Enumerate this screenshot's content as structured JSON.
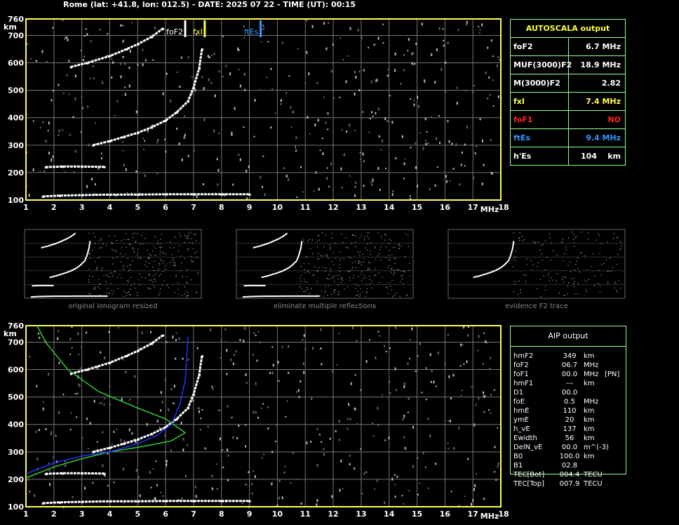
{
  "header": "Rome (lat: +41.8, lon: 012.5) - DATE: 2025 07 22 - TIME (UT): 00:15",
  "colors": {
    "axis": "#ffff55",
    "grid": "#777777",
    "trace": "#ffffff",
    "fof2": "#ffffff",
    "fxi": "#ffff44",
    "ftes": "#3399ff",
    "fof1": "#ff2222",
    "table_border": "#99ff99",
    "profile_green": "#33cc33",
    "profile_blue": "#2233ff"
  },
  "chart_data": {
    "type": "scatter",
    "xlabel": "MHz",
    "ylabel": "km",
    "xlim": [
      1,
      18
    ],
    "ylim": [
      100,
      760
    ],
    "x_ticks": [
      "1",
      "2",
      "3",
      "4",
      "5",
      "6",
      "7",
      "8",
      "9",
      "10",
      "11",
      "12",
      "13",
      "14",
      "15",
      "16",
      "17",
      "18"
    ],
    "y_ticks": [
      "100",
      "200",
      "300",
      "400",
      "500",
      "600",
      "700",
      "760"
    ],
    "markers": [
      {
        "label": "foF2",
        "freq": 6.7,
        "color": "#ffffff"
      },
      {
        "label": "fxI",
        "freq": 7.4,
        "color": "#ffff44"
      },
      {
        "label": "ftEs",
        "freq": 9.4,
        "color": "#3399ff"
      }
    ],
    "series": [
      {
        "values": [
          [
            1.6,
            113
          ],
          [
            2.2,
            116
          ],
          [
            3,
            118
          ],
          [
            4,
            120
          ],
          [
            5,
            120
          ],
          [
            6,
            121
          ],
          [
            7,
            121
          ],
          [
            8,
            121
          ],
          [
            9,
            121
          ]
        ]
      },
      {
        "values": [
          [
            1.7,
            220
          ],
          [
            2.3,
            222
          ],
          [
            3,
            222
          ],
          [
            3.8,
            221
          ]
        ]
      },
      {
        "values": [
          [
            3.4,
            300
          ],
          [
            4,
            315
          ],
          [
            4.5,
            330
          ],
          [
            5,
            345
          ],
          [
            5.5,
            365
          ],
          [
            6,
            390
          ],
          [
            6.4,
            420
          ],
          [
            6.8,
            460
          ],
          [
            7,
            510
          ],
          [
            7.2,
            580
          ],
          [
            7.3,
            650
          ]
        ]
      },
      {
        "values": [
          [
            2.6,
            585
          ],
          [
            3.2,
            600
          ],
          [
            4,
            625
          ],
          [
            4.6,
            650
          ],
          [
            5,
            668
          ],
          [
            5.5,
            695
          ],
          [
            5.9,
            725
          ]
        ]
      }
    ],
    "profiles": [
      {
        "values": [
          [
            1.4,
            760
          ],
          [
            1.7,
            700
          ],
          [
            2.5,
            600
          ],
          [
            3.6,
            520
          ],
          [
            5,
            460
          ],
          [
            6,
            420
          ],
          [
            6.7,
            370
          ],
          [
            6.2,
            340
          ],
          [
            5.2,
            320
          ],
          [
            4,
            300
          ],
          [
            3,
            275
          ],
          [
            2,
            245
          ],
          [
            1,
            205
          ]
        ]
      },
      {
        "values": [
          [
            1,
            220
          ],
          [
            2,
            260
          ],
          [
            3,
            285
          ],
          [
            4,
            300
          ],
          [
            5,
            330
          ],
          [
            5.7,
            360
          ],
          [
            6.2,
            400
          ],
          [
            6.5,
            470
          ],
          [
            6.7,
            560
          ],
          [
            6.8,
            720
          ]
        ]
      }
    ]
  },
  "autoscala": {
    "title": "AUTOSCALA output",
    "rows": [
      {
        "label": "foF2",
        "value": "6.7 MHz",
        "color": "#ffffff"
      },
      {
        "label": "MUF(3000)F2",
        "value": "18.9 MHz",
        "color": "#ffffff"
      },
      {
        "label": "M(3000)F2",
        "value": "2.82",
        "color": "#ffffff"
      },
      {
        "label": "fxI",
        "value": "7.4 MHz",
        "color": "#ffff44"
      },
      {
        "label": "foF1",
        "value": "NO",
        "color": "#ff2222"
      },
      {
        "label": "ftEs",
        "value": "9.4 MHz",
        "color": "#3399ff"
      },
      {
        "label": "h'Es",
        "value": "104    km",
        "color": "#ffffff"
      }
    ]
  },
  "thumbnails": [
    {
      "caption": "original ionogram resized"
    },
    {
      "caption": "eliminate multiple reflections"
    },
    {
      "caption": "evidence F2 trace"
    }
  ],
  "aip": {
    "title": "AIP output",
    "rows": [
      [
        "hmF2",
        "349",
        "km",
        ""
      ],
      [
        "foF2",
        "06.7",
        "MHz",
        ""
      ],
      [
        "foF1",
        "00.0",
        "MHz",
        "[PN]"
      ],
      [
        "hmF1",
        "---",
        "km",
        ""
      ],
      [
        "D1",
        "00.0",
        "",
        ""
      ],
      [
        "foE",
        "0.5",
        "MHz",
        ""
      ],
      [
        "hmE",
        "110",
        "km",
        ""
      ],
      [
        "ymE",
        "20",
        "km",
        ""
      ],
      [
        "h_vE",
        "137",
        "km",
        ""
      ],
      [
        "Ewidth",
        "56",
        "km",
        ""
      ],
      [
        "DelN_vE",
        "00.0",
        "m^(-3)",
        ""
      ],
      [
        "B0",
        "100.0",
        "km",
        ""
      ],
      [
        "B1",
        "02.8",
        "",
        ""
      ],
      [
        "TEC[Bot]",
        "004.4",
        "TECU",
        ""
      ],
      [
        "TEC[Top]",
        "007.9",
        "TECU",
        ""
      ]
    ]
  }
}
